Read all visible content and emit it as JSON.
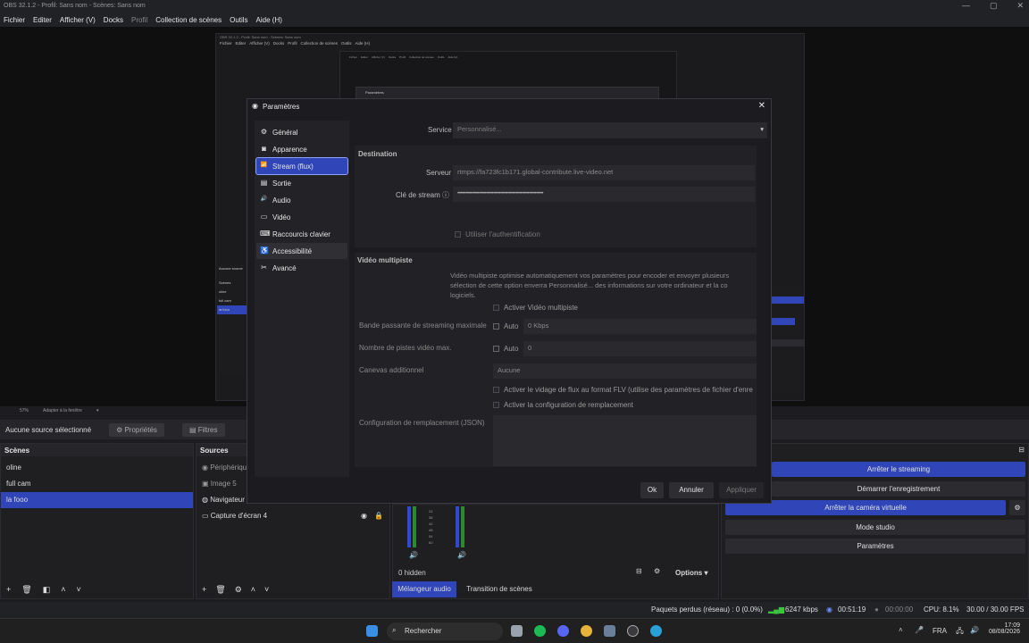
{
  "window": {
    "title": "OBS 32.1.2 - Profil: Sans nom - Scènes: Sans nom",
    "controls": [
      "—",
      "▢",
      "✕"
    ]
  },
  "menubar": [
    {
      "label": "Fichier"
    },
    {
      "label": "Editer"
    },
    {
      "label": "Afficher (V)"
    },
    {
      "label": "Docks"
    },
    {
      "label": "Profil"
    },
    {
      "label": "Collection de scènes"
    },
    {
      "label": "Outils"
    },
    {
      "label": "Aide (H)"
    }
  ],
  "preview": {
    "inner_title": "OBS 32.1.2 - Profil: Sans nom - Scènes: Sans nom",
    "inner_menu": [
      "Fichier",
      "Editer",
      "Afficher (V)",
      "Docks",
      "Profil",
      "Collection de scènes",
      "Outils",
      "Aide (H)"
    ],
    "inner_settings_title": "Paramètres",
    "inner_scenes_header": "Aucune source",
    "inner_scenes": [
      "Scènes",
      "oline",
      "full cam",
      "la fooo"
    ],
    "zoom": "57%",
    "fit_label": "Adapter à la fenêtre"
  },
  "source_toolbar": {
    "no_source": "Aucune source sélectionné",
    "properties": "Propriétés",
    "filters": "Filtres"
  },
  "scenes": {
    "header": "Scènes",
    "items": [
      {
        "label": "oline",
        "selected": false
      },
      {
        "label": "full cam",
        "selected": false
      },
      {
        "label": "la fooo",
        "selected": true
      }
    ]
  },
  "sources": {
    "header": "Sources",
    "items": [
      {
        "label": "Périphérique"
      },
      {
        "label": "Image 5"
      },
      {
        "label": "Navigateur"
      },
      {
        "label": "Capture d'écran 4"
      }
    ]
  },
  "mixer": {
    "scale": [
      "24",
      "36",
      "42",
      "48",
      "54",
      "60"
    ],
    "hidden": "0 hidden",
    "options": "Options",
    "tabs": [
      "Mélangeur audio",
      "Transition de scènes"
    ]
  },
  "controls": {
    "stop_streaming": "Arrêter le streaming",
    "start_recording": "Démarrer l'enregistrement",
    "stop_virtual_cam": "Arrêter la caméra virtuelle",
    "studio_mode": "Mode studio",
    "settings": "Paramètres"
  },
  "status": {
    "dropped": "Paquets perdus (réseau) : 0 (0.0%)",
    "bitrate": "6247 kbps",
    "stream_time": "00:51:19",
    "rec_time": "00:00:00",
    "cpu": "CPU: 8.1%",
    "fps": "30.00 / 30.00 FPS"
  },
  "taskbar": {
    "search": "Rechercher",
    "lang": "FRA",
    "time": "17:09",
    "date": "08/08/2026"
  },
  "dialog": {
    "title": "Paramètres",
    "nav": [
      {
        "label": "Général",
        "icon": "gear-icon",
        "glyph": "⚙"
      },
      {
        "label": "Apparence",
        "icon": "palette-icon",
        "glyph": "◙"
      },
      {
        "label": "Stream (flux)",
        "icon": "antenna-icon",
        "glyph": "📶"
      },
      {
        "label": "Sortie",
        "icon": "output-icon",
        "glyph": "▤"
      },
      {
        "label": "Audio",
        "icon": "speaker-icon",
        "glyph": "🔊"
      },
      {
        "label": "Vidéo",
        "icon": "monitor-icon",
        "glyph": "▭"
      },
      {
        "label": "Raccourcis clavier",
        "icon": "keyboard-icon",
        "glyph": "⌨"
      },
      {
        "label": "Accessibilité",
        "icon": "accessibility-icon",
        "glyph": "♿"
      },
      {
        "label": "Avancé",
        "icon": "tools-icon",
        "glyph": "✂"
      }
    ],
    "service_label": "Service",
    "service_value": "Personnalisé...",
    "destination": "Destination",
    "server_label": "Serveur",
    "server_value": "rtmps://fa723fc1b171.global-contribute.live-video.net",
    "key_label": "Clé de stream",
    "key_value": "••••••••••••••••••••••••••••••••••••••••••••••••••••••••••••",
    "use_auth": "Utiliser l'authentification",
    "multitrack_title": "Vidéo multipiste",
    "multitrack_desc1": "Vidéo multipiste optimise automatiquement vos paramètres pour encoder et envoyer plusieurs",
    "multitrack_desc2": "sélection de cette option enverra Personnalisé... des informations sur votre ordinateur et la co",
    "multitrack_desc3": "logiciels.",
    "enable_multitrack": "Activer Vidéo multipiste",
    "max_bw_label": "Bande passante de streaming maximale",
    "auto": "Auto",
    "max_bw_value": "0 Kbps",
    "max_tracks_label": "Nombre de pistes vidéo max.",
    "max_tracks_value": "0",
    "canvas_label": "Canevas additionnel",
    "canvas_value": "Aucune",
    "flv_dump": "Activer le vidage de flux au format FLV (utilise des paramètres de fichier d'enre",
    "override_config": "Activer la configuration de remplacement",
    "override_json_label": "Configuration de remplacement (JSON)",
    "ok": "Ok",
    "cancel": "Annuler",
    "apply": "Appliquer"
  }
}
